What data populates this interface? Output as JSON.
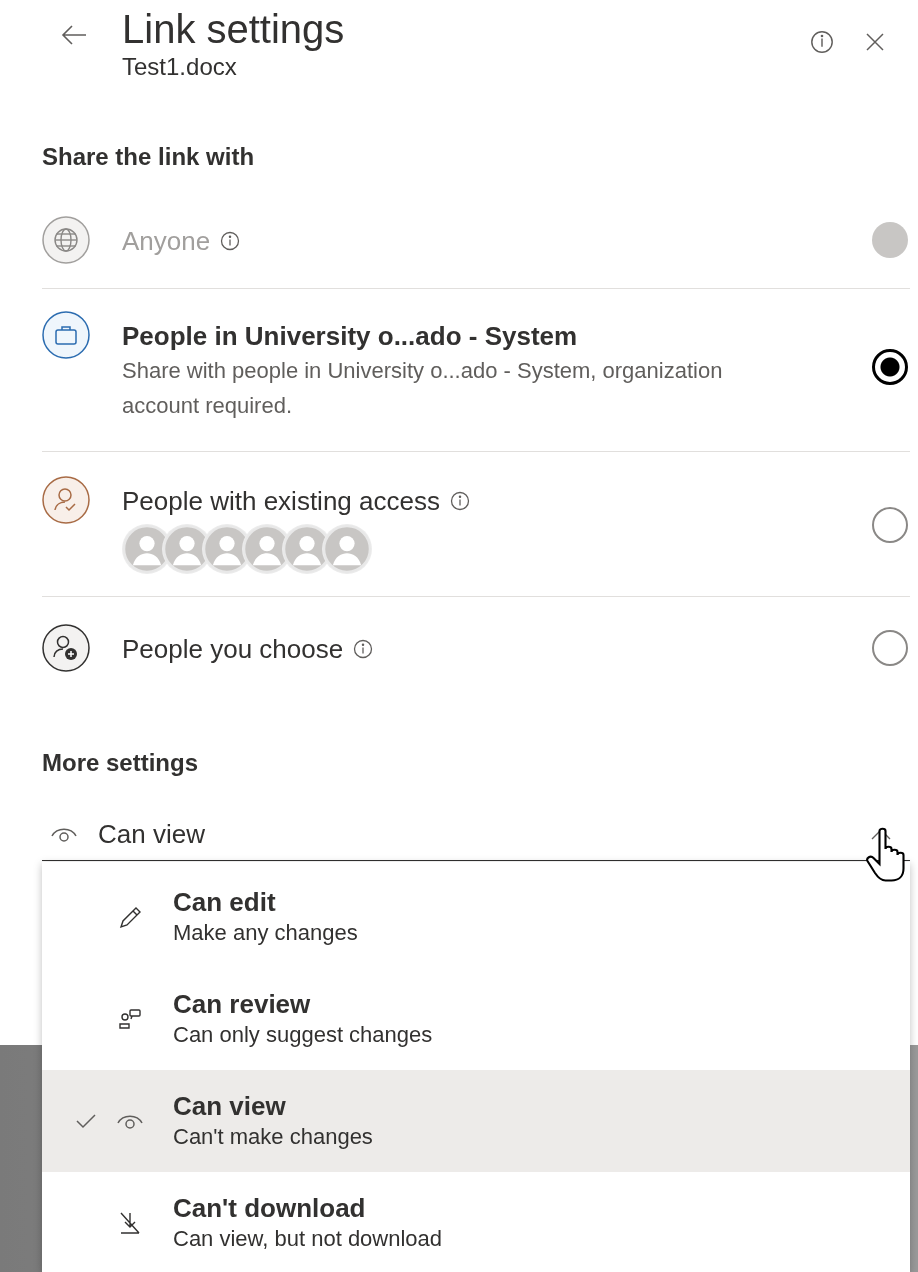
{
  "header": {
    "title": "Link settings",
    "subtitle": "Test1.docx"
  },
  "share_section": {
    "heading": "Share the link with",
    "options": [
      {
        "kind": "anyone",
        "label": "Anyone",
        "info": true,
        "disabled": true,
        "selected": false
      },
      {
        "kind": "organization",
        "label": "People in University o...ado - System",
        "description": "Share with people in University o...ado - System, organization account required.",
        "info": false,
        "disabled": false,
        "selected": true
      },
      {
        "kind": "existing",
        "label": "People with existing access",
        "info": true,
        "disabled": false,
        "selected": false
      },
      {
        "kind": "specific",
        "label": "People you choose",
        "info": true,
        "disabled": false,
        "selected": false
      }
    ]
  },
  "more_settings": {
    "heading": "More settings",
    "dropdown": {
      "value": "Can view",
      "expanded": true
    },
    "menu": [
      {
        "kind": "edit",
        "title": "Can edit",
        "description": "Make any changes",
        "selected": false
      },
      {
        "kind": "review",
        "title": "Can review",
        "description": "Can only suggest changes",
        "selected": false
      },
      {
        "kind": "view",
        "title": "Can view",
        "description": "Can't make changes",
        "selected": true
      },
      {
        "kind": "nodownload",
        "title": "Can't download",
        "description": "Can view, but not download",
        "selected": false
      }
    ]
  }
}
